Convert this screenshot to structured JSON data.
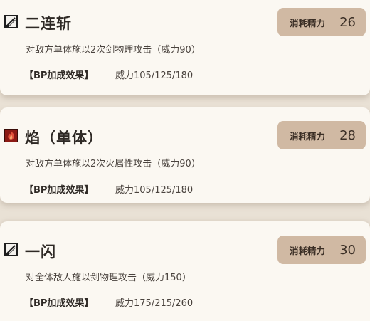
{
  "skills": [
    {
      "icon": "sword-icon",
      "name": "二连斩",
      "description": "对敌方单体施以2次剑物理攻击（威力90）",
      "bp_label": "【BP加成效果】",
      "bp_value": "威力105/125/180",
      "cost_label": "消耗精力",
      "cost_value": "26"
    },
    {
      "icon": "fire-icon",
      "name": "焰（单体）",
      "description": "对敌方单体施以2次火属性攻击（威力90）",
      "bp_label": "【BP加成效果】",
      "bp_value": "威力105/125/180",
      "cost_label": "消耗精力",
      "cost_value": "28"
    },
    {
      "icon": "sword-icon",
      "name": "一闪",
      "description": "对全体敌人施以剑物理攻击（威力150）",
      "bp_label": "【BP加成效果】",
      "bp_value": "威力175/215/260",
      "cost_label": "消耗精力",
      "cost_value": "30"
    }
  ],
  "colors": {
    "card_bg": "#fbf8f2",
    "page_bg": "#e9e1d5",
    "cost_badge_bg": "#d0b9a3",
    "fire_icon_bg": "#8c1a14"
  }
}
